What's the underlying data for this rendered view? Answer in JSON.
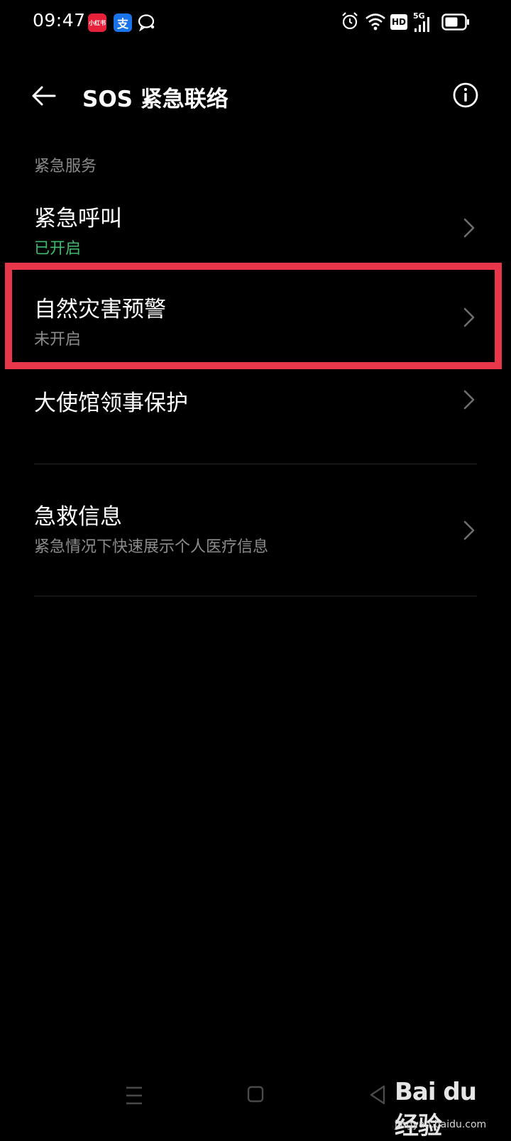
{
  "status_bar": {
    "time": "09:47",
    "app_icons": [
      {
        "name": "xiaohongshu-icon",
        "label": "小红书",
        "color": "#e8213a"
      },
      {
        "name": "alipay-icon",
        "label": "支",
        "color": "#1a73e8"
      },
      {
        "name": "message-icon"
      }
    ],
    "right_icons": [
      "alarm-icon",
      "wifi-icon",
      "hd-icon",
      "5g-signal-icon",
      "battery-icon"
    ],
    "hd_label": "HD",
    "network_label": "5G"
  },
  "app_bar": {
    "title": "SOS 紧急联络"
  },
  "section": {
    "header": "紧急服务",
    "items": [
      {
        "title": "紧急呼叫",
        "subtitle": "已开启",
        "subtitle_state": "on"
      },
      {
        "title": "自然灾害预警",
        "subtitle": "未开启",
        "subtitle_state": "off",
        "highlighted": true
      },
      {
        "title": "大使馆领事保护"
      }
    ]
  },
  "section2": {
    "items": [
      {
        "title": "急救信息",
        "subtitle": "紧急情况下快速展示个人医疗信息"
      }
    ]
  },
  "watermark": {
    "logo": "Bai du 经验",
    "url": "jingyan.baidu.com"
  },
  "colors": {
    "background": "#000000",
    "status_on": "#3fba6e",
    "secondary_text": "#8c8c8c",
    "highlight": "#e8364a"
  }
}
